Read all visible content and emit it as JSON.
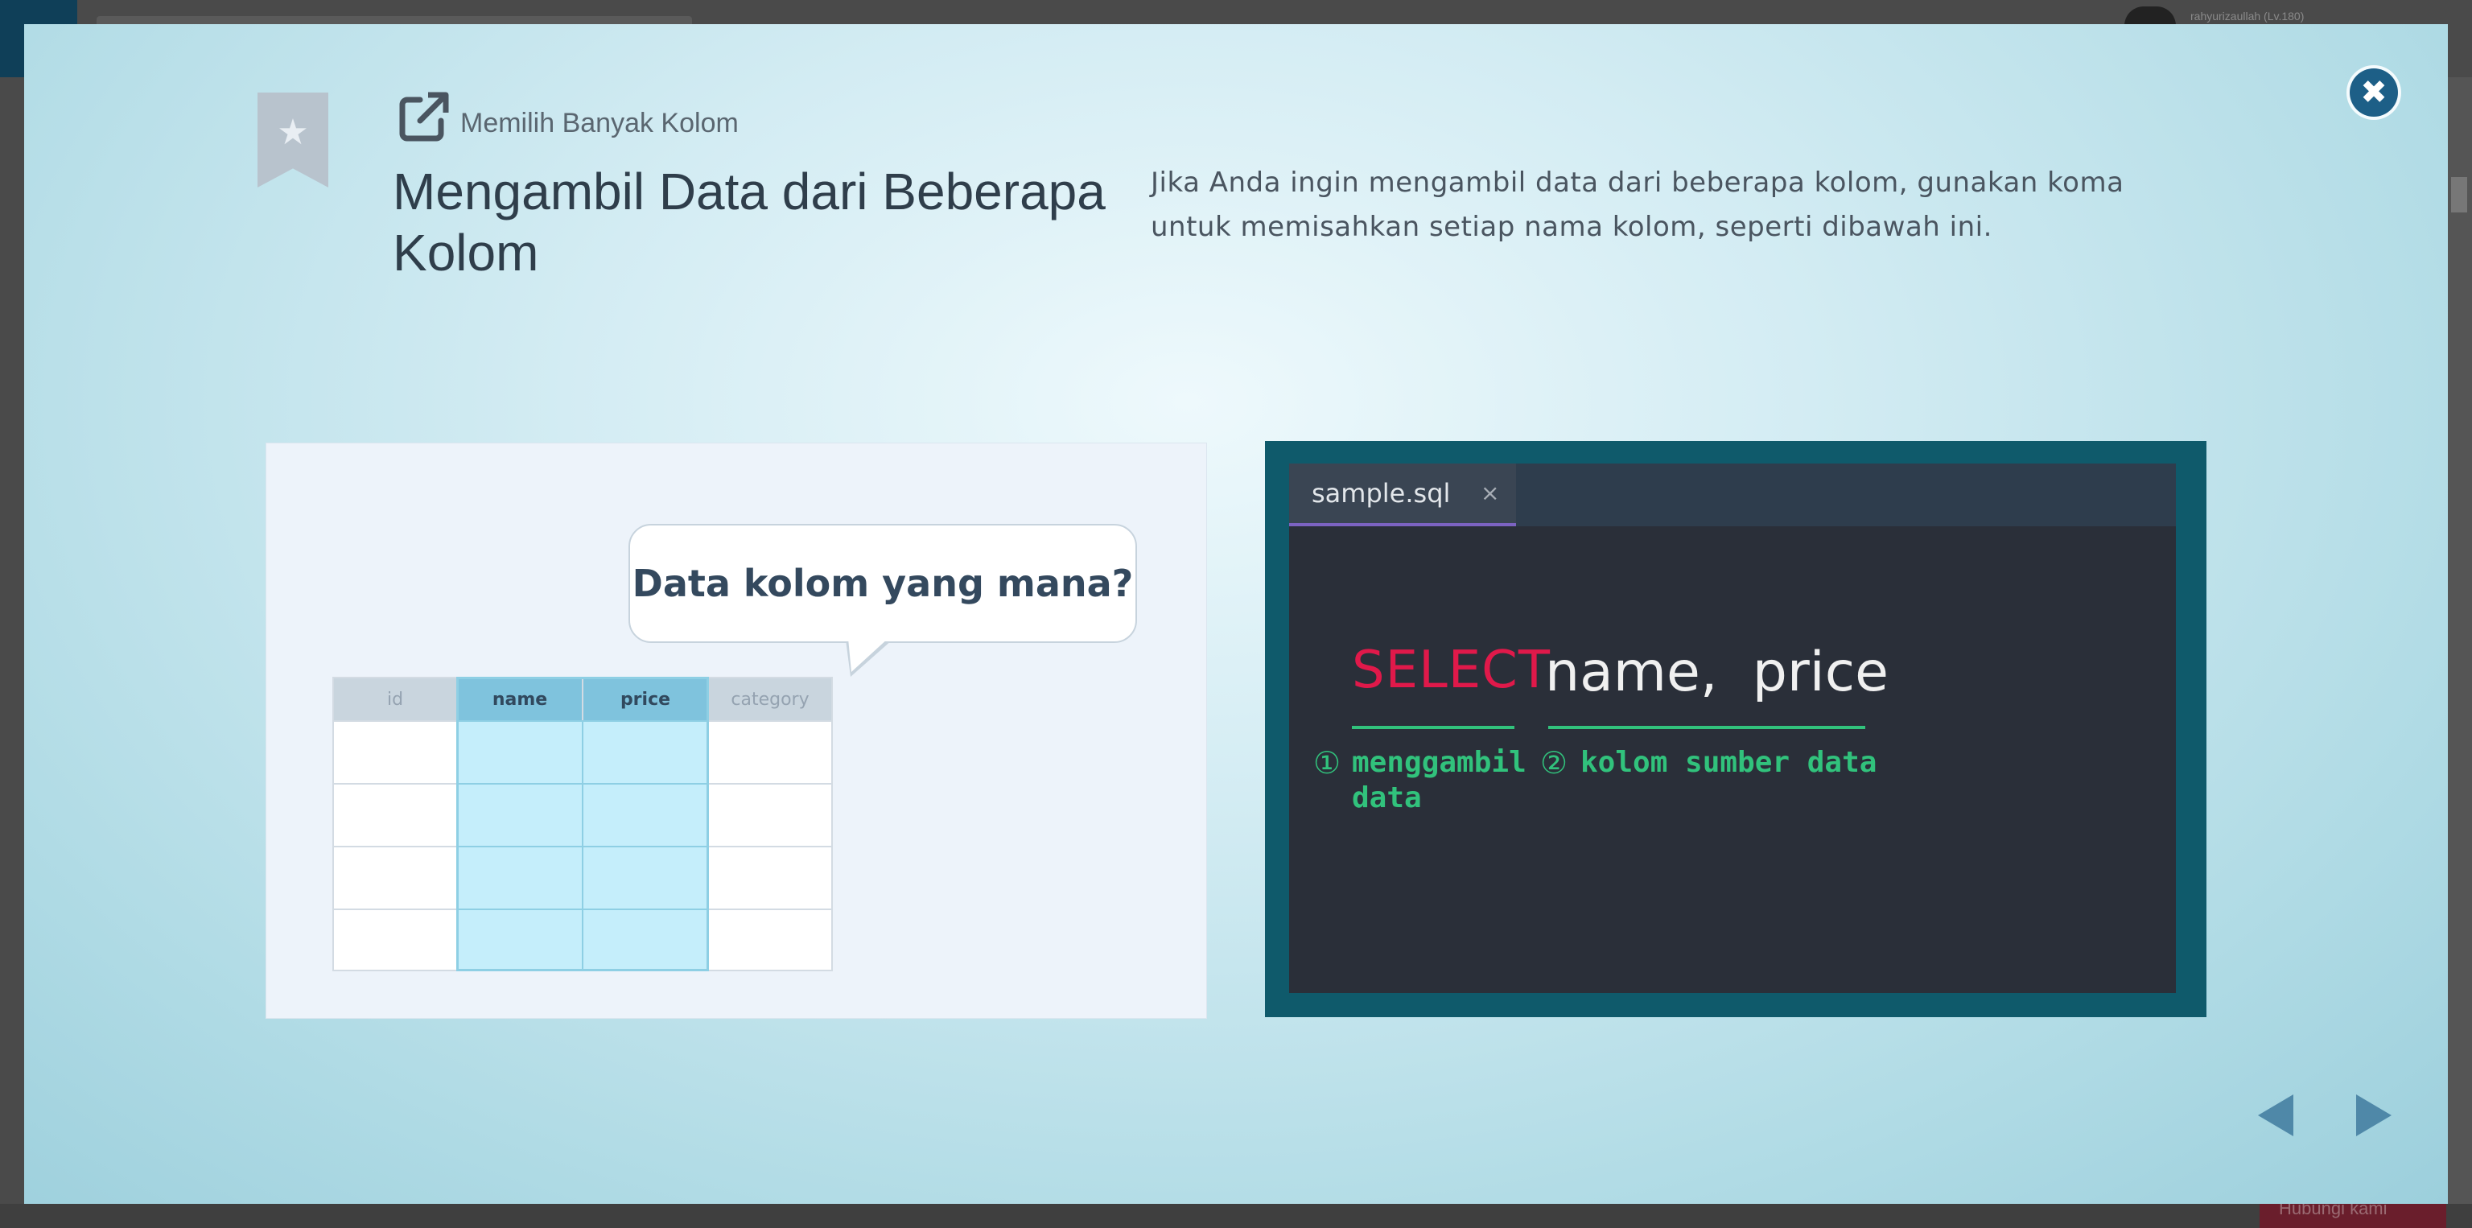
{
  "background": {
    "username": "rahyurizaullah (Lv.180)",
    "bottom_button": "Hubungi kami"
  },
  "modal": {
    "subtitle": "Memilih Banyak Kolom",
    "title": "Mengambil Data dari Beberapa Kolom",
    "description": "Jika Anda ingin mengambil data dari beberapa kolom, gunakan koma untuk memisahkan setiap nama kolom, seperti dibawah ini.",
    "close_icon": "close-icon",
    "bookmark_icon": "star-icon"
  },
  "illustration": {
    "bubble_text": "Data kolom yang mana?",
    "table": {
      "headers": [
        "id",
        "name",
        "price",
        "category"
      ],
      "highlighted_columns": [
        "name",
        "price"
      ],
      "row_count": 4
    }
  },
  "code": {
    "tab_label": "sample.sql",
    "tab_close": "×",
    "keyword": "SELECT",
    "columns": "name,  price",
    "annotation1_num": "①",
    "annotation1": "menggambil\ndata",
    "annotation2_num": "②",
    "annotation2": "kolom sumber data"
  },
  "navigation": {
    "prev_icon": "triangle-left-icon",
    "next_icon": "triangle-right-icon"
  },
  "colors": {
    "keyword": "#e0194a",
    "annotation": "#31c27c",
    "highlight": "#c5eefb",
    "close_button": "#1d5f87"
  }
}
